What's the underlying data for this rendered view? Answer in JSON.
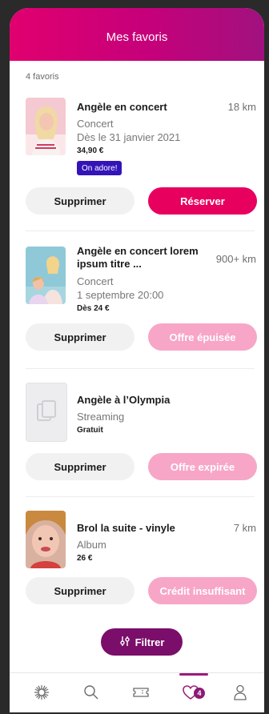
{
  "header": {
    "title": "Mes favoris"
  },
  "list": {
    "count_label": "4 favoris"
  },
  "items": [
    {
      "title": "Angèle en concert",
      "distance": "18 km",
      "type": "Concert",
      "date": "Dès le 31 janvier 2021",
      "price": "34,90 €",
      "badge": "On adore!",
      "remove_label": "Supprimer",
      "action_label": "Réserver"
    },
    {
      "title": "Angèle en concert lorem ipsum titre ...",
      "distance": "900+ km",
      "type": "Concert",
      "date": "1 septembre 20:00",
      "price": "Dès 24 €",
      "remove_label": "Supprimer",
      "action_label": "Offre épuisée"
    },
    {
      "title": "Angèle à l’Olympia",
      "type": "Streaming",
      "price": "Gratuit",
      "remove_label": "Supprimer",
      "action_label": "Offre expirée"
    },
    {
      "title": "Brol la suite - vinyle",
      "distance": "7 km",
      "type": "Album",
      "price": "26 €",
      "remove_label": "Supprimer",
      "action_label": "Crédit insuffisant"
    }
  ],
  "filter": {
    "label": "Filtrer",
    "icon": "sliders-icon"
  },
  "tabbar": {
    "tabs": [
      {
        "icon": "home-logo-icon"
      },
      {
        "icon": "search-icon"
      },
      {
        "icon": "ticket-icon"
      },
      {
        "icon": "heart-icon",
        "badge": "4",
        "active": true
      },
      {
        "icon": "profile-icon"
      }
    ]
  },
  "colors": {
    "header_start": "#e1006f",
    "header_end": "#a1117f",
    "primary_button": "#e8005f",
    "disabled_button": "#f7a6c7",
    "badge": "#3314b8",
    "filter_button": "#7b0e6a"
  }
}
